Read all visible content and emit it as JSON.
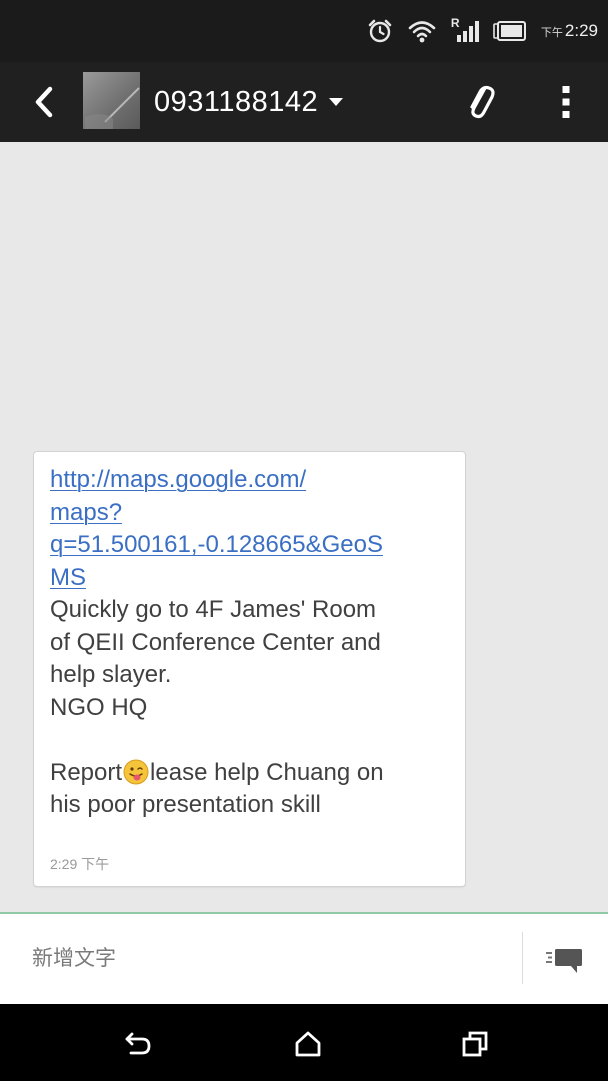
{
  "status_bar": {
    "icons": [
      "alarm-icon",
      "wifi-icon",
      "roaming-signal-icon",
      "battery-icon"
    ],
    "roaming_label": "R",
    "time_ampm": "下午",
    "time": "2:29"
  },
  "app_bar": {
    "back_icon": "back-chevron-icon",
    "contact_number": "0931188142",
    "dropdown_icon": "caret-down-icon",
    "attach_icon": "paperclip-icon",
    "overflow_icon": "more-vert-icon"
  },
  "message": {
    "link_lines": [
      "http://maps.google.com/",
      "maps?",
      "q=51.500161,-0.128665&GeoS",
      "MS"
    ],
    "body_lines": [
      "Quickly go to 4F James' Room",
      "of QEII Conference Center and",
      "help slayer.",
      "NGO HQ"
    ],
    "report_prefix": "Report",
    "report_emoji": "tongue-out-emoji",
    "report_suffix": "lease help Chuang on",
    "report_line2": "his poor presentation skill",
    "timestamp": "2:29 下午"
  },
  "compose": {
    "placeholder": "新增文字",
    "value": "",
    "send_icon": "send-message-icon"
  },
  "nav_bar": {
    "icons": [
      "back-nav-icon",
      "home-icon",
      "recents-icon"
    ]
  },
  "colors": {
    "link": "#3a6fc4",
    "app_bar": "#202020",
    "compose_border": "#8fc9a8",
    "conversation_bg": "#e8e8e8"
  }
}
